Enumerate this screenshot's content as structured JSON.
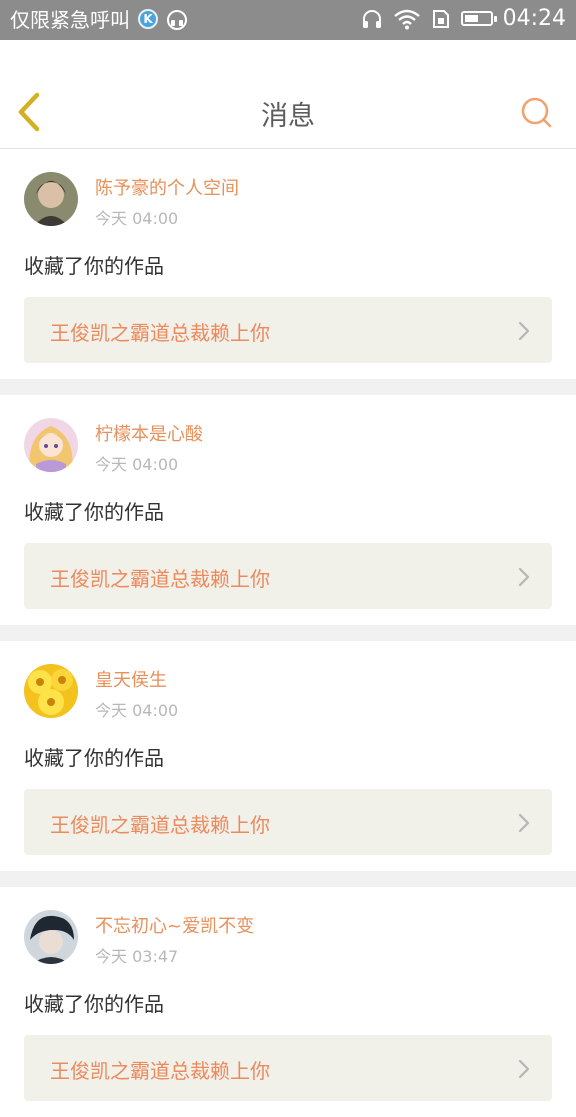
{
  "status_bar": {
    "left_text": "仅限紧急呼叫",
    "k_badge": "K",
    "time": "04:24",
    "battery_level": 0.55,
    "icons": [
      "k-app-icon",
      "headset-icon",
      "headphones-icon",
      "wifi-icon",
      "sim-icon",
      "battery-icon"
    ]
  },
  "header": {
    "title": "消息",
    "back_icon": "chevron-left-icon",
    "search_icon": "search-icon"
  },
  "colors": {
    "accent": "#ec8a5e",
    "back_arrow": "#d4b021",
    "card_bg": "#ffffff",
    "work_box_bg": "#f1f1ea"
  },
  "messages": [
    {
      "username": "陈予豪的个人空间",
      "time": "今天 04:00",
      "action": "收藏了你的作品",
      "work_title": "王俊凯之霸道总裁赖上你",
      "avatar": "avatar-photo-dark"
    },
    {
      "username": "柠檬本是心酸",
      "time": "今天 04:00",
      "action": "收藏了你的作品",
      "work_title": "王俊凯之霸道总裁赖上你",
      "avatar": "avatar-anime-girl"
    },
    {
      "username": "皇天侯生",
      "time": "今天 04:00",
      "action": "收藏了你的作品",
      "work_title": "王俊凯之霸道总裁赖上你",
      "avatar": "avatar-sunflowers"
    },
    {
      "username": "不忘初心~爱凯不变",
      "time": "今天 03:47",
      "action": "收藏了你的作品",
      "work_title": "王俊凯之霸道总裁赖上你",
      "avatar": "avatar-photo-boy"
    }
  ]
}
